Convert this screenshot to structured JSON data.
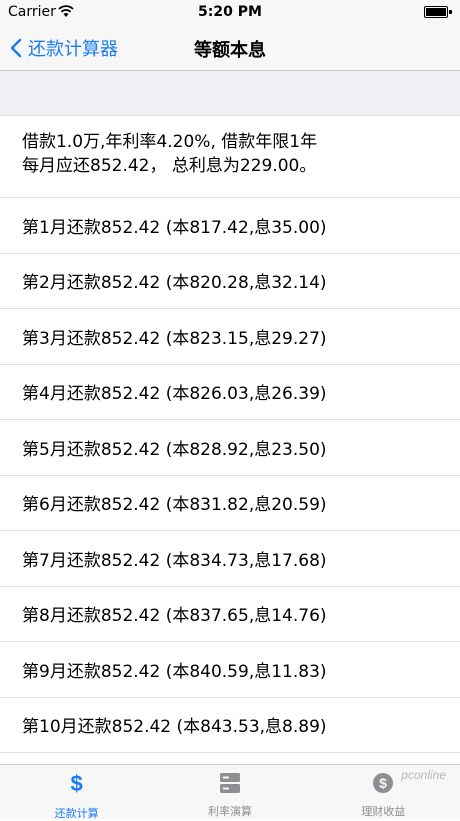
{
  "status_bar": {
    "carrier": "Carrier",
    "time": "5:20 PM"
  },
  "nav": {
    "back_label": "还款计算器",
    "title": "等额本息"
  },
  "summary": {
    "line1": "借款1.0万,年利率4.20%, 借款年限1年",
    "line2": "每月应还852.42， 总利息为229.00。"
  },
  "rows": [
    "第1月还款852.42 (本817.42,息35.00)",
    "第2月还款852.42 (本820.28,息32.14)",
    "第3月还款852.42 (本823.15,息29.27)",
    "第4月还款852.42 (本826.03,息26.39)",
    "第5月还款852.42 (本828.92,息23.50)",
    "第6月还款852.42 (本831.82,息20.59)",
    "第7月还款852.42 (本834.73,息17.68)",
    "第8月还款852.42 (本837.65,息14.76)",
    "第9月还款852.42 (本840.59,息11.83)",
    "第10月还款852.42 (本843.53,息8.89)"
  ],
  "tabs": [
    {
      "label": "还款计算",
      "icon": "dollar-icon",
      "active": true
    },
    {
      "label": "利率演算",
      "icon": "server-icon",
      "active": false
    },
    {
      "label": "理财收益",
      "icon": "coin-icon",
      "active": false
    }
  ],
  "watermark": "pconline",
  "colors": {
    "accent": "#1a7cf5",
    "inactive": "#8e8e93",
    "bar_bg": "#f7f7f7"
  }
}
